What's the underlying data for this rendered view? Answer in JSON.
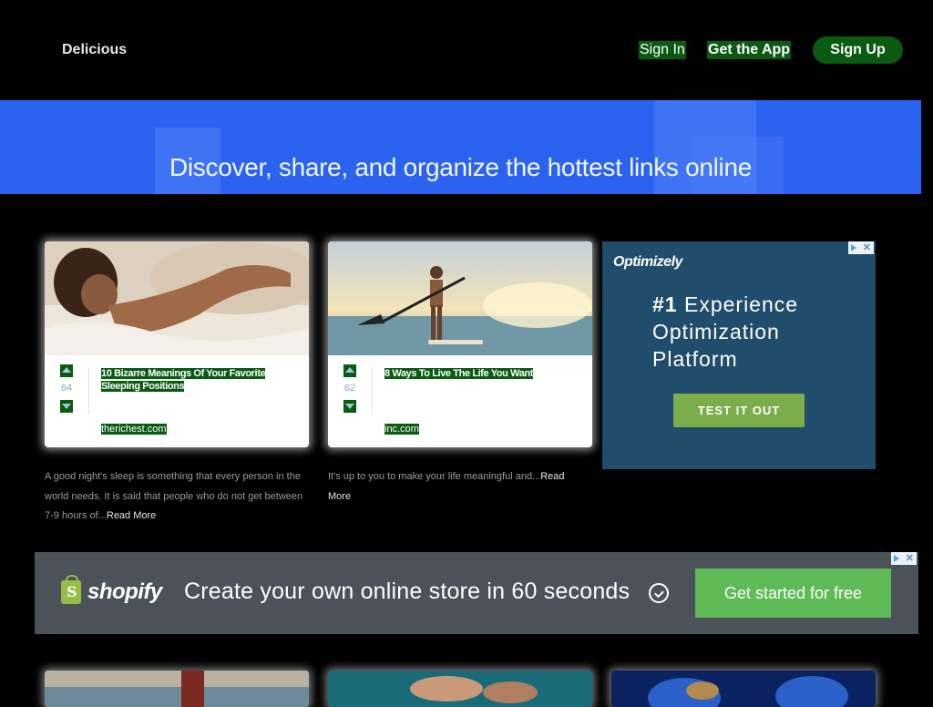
{
  "header": {
    "logo": "Delicious",
    "sign_in": "Sign In",
    "get_app": "Get the App",
    "sign_up": "Sign Up"
  },
  "hero": {
    "tagline": "Discover, share, and organize the hottest links online"
  },
  "cards": [
    {
      "votes": "64",
      "title": "10 Bizarre Meanings Of Your Favorite Sleeping Positions",
      "domain": "therichest.com",
      "description": "A good night's sleep is something that every person in the world needs. It is said that people who do not get between 7-9 hours of...",
      "read_more": "Read More",
      "image": "woman-sleeping-photo"
    },
    {
      "votes": "62",
      "title": "8 Ways To Live The Life You Want",
      "domain": "inc.com",
      "description": "It's up to you to make your life meaningful and...",
      "read_more": "Read More",
      "image": "paddleboarder-sunset-photo"
    }
  ],
  "ad_optimizely": {
    "brand": "Optimizely",
    "headline_bold": "#1",
    "headline": " Experience Optimization Platform",
    "button": "TEST IT OUT",
    "adchoices_icon": "adchoices-icon",
    "close_glyph": "✕"
  },
  "ad_shopify": {
    "brand": "shopify",
    "text": "Create your own online store in 60 seconds",
    "button": "Get started for free",
    "adchoices_icon": "adchoices-icon",
    "close_glyph": "✕"
  },
  "colors": {
    "accent_green": "#0a5a12",
    "hero_blue": "#2b63f0",
    "ad_blue": "#1f4d6b",
    "shopify_green": "#95bf47",
    "shopify_button": "#5fbb56"
  }
}
